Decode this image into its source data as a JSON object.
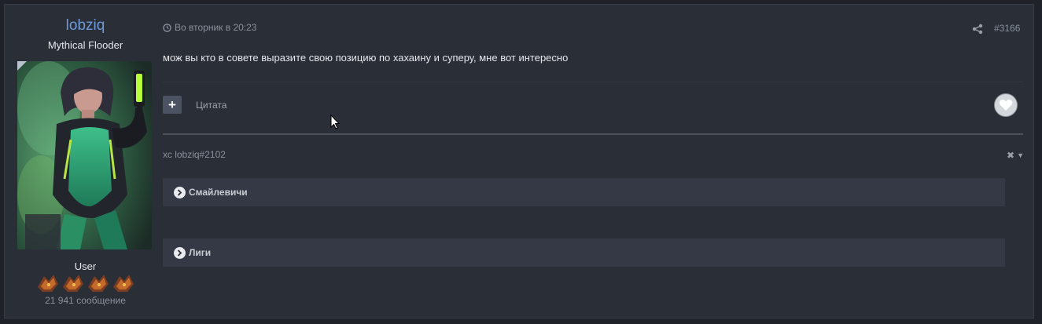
{
  "author": {
    "username": "lobziq",
    "title": "Mythical Flooder",
    "role": "User",
    "message_count": "21 941 сообщение",
    "rank_icons": [
      "rank-badge-icon",
      "rank-badge-icon",
      "rank-badge-icon",
      "rank-badge-icon"
    ]
  },
  "post": {
    "date": "Во вторник в 20:23",
    "number": "#3166",
    "message": "мож вы кто в совете выразите свою позицию по хахаину и суперу, мне вот интересно",
    "quote_label": "Цитата",
    "plus_label": "+",
    "signature_title": "хс lobziq#2102",
    "spoilers": [
      {
        "label": "Смайлевичи"
      },
      {
        "label": "Лиги"
      }
    ]
  },
  "colors": {
    "username": "#6d99da",
    "background": "#2a2e37",
    "spoiler_bg": "#343945"
  }
}
